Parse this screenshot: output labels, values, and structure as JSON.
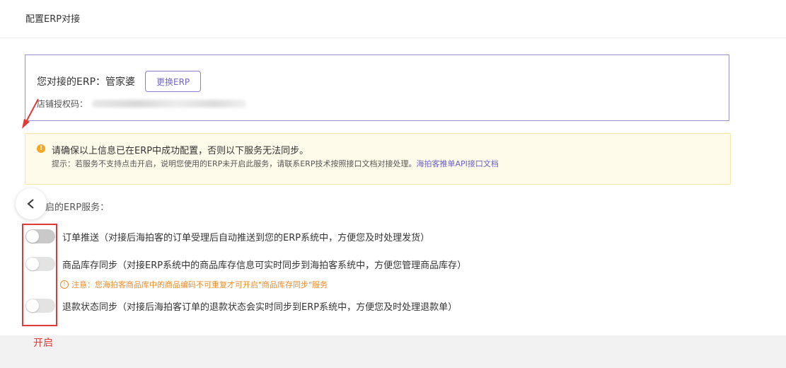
{
  "header": {
    "title": "配置ERP对接"
  },
  "erp": {
    "label": "您对接的ERP：",
    "name": "管家婆",
    "change_button": "更换ERP",
    "auth_label": "店铺授权码："
  },
  "notice": {
    "title": "请确保以上信息已在ERP中成功配置，否则以下服务无法同步。",
    "tip": "提示：若服务不支持点击开启，说明您使用的ERP未开启此服务，请联系ERP技术按照接口文档对接处理。",
    "link": "海拍客推单API接口文档"
  },
  "services": {
    "label": "可开启的ERP服务：",
    "items": [
      {
        "text": "订单推送（对接后海拍客的订单受理后自动推送到您的ERP系统中，方便您及时处理发货）",
        "enabled": false
      },
      {
        "text": "商品库存同步（对接ERP系统中的商品库存信息可实时同步到海拍客系统中，方便您管理商品库存）",
        "enabled": false
      },
      {
        "text": "退款状态同步（对接后海拍客订单的退款状态会实时同步到ERP系统中，方便您及时处理退款单）",
        "enabled": false
      }
    ],
    "stock_note": "注意：您海拍客商品库中的商品编码不可重复才可开启\"商品库存同步\"服务"
  },
  "annotation": {
    "label": "开启"
  },
  "colors": {
    "accent": "#7367c9",
    "warning": "#f5a623",
    "annotation": "#e53935"
  }
}
